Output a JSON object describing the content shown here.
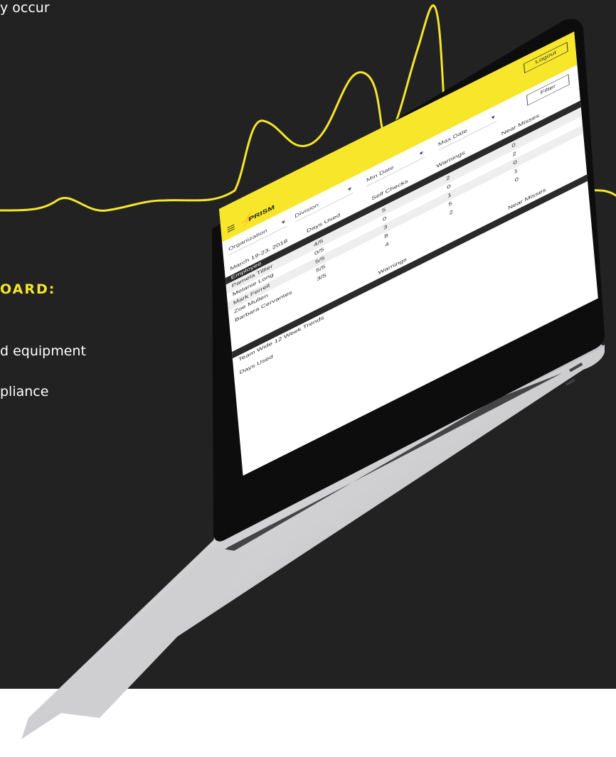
{
  "hero": {
    "top_text": "y occur",
    "heading": "OARD:",
    "bullet_1": "d equipment",
    "bullet_2": "pliance"
  },
  "app": {
    "logo": "PRISM",
    "logout_label": "Logout",
    "filters": {
      "organization": "Organization",
      "division": "Division",
      "min_date": "Min Date",
      "max_date": "Max Date",
      "filter_button": "Filter"
    },
    "date_range": "March 19-23, 2018",
    "table": {
      "headers": [
        "Employee",
        "Days Used",
        "Self Checks",
        "Warnings",
        "Near Misses"
      ],
      "rows": [
        {
          "name": "Pamela Tillier",
          "days": "4/5",
          "checks": "5",
          "warnings": "2",
          "misses": "0"
        },
        {
          "name": "Melanie Long",
          "days": "0/5",
          "checks": "0",
          "warnings": "0",
          "misses": "2"
        },
        {
          "name": "Mark Ferrell",
          "days": "5/5",
          "checks": "3",
          "warnings": "1",
          "misses": "0"
        },
        {
          "name": "Zoe Mullen",
          "days": "5/5",
          "checks": "8",
          "warnings": "5",
          "misses": "1"
        },
        {
          "name": "Barbara Cervantes",
          "days": "3/5",
          "checks": "4",
          "warnings": "2",
          "misses": "0"
        }
      ]
    },
    "trends": {
      "title": "Team Wide 12 Week Trends",
      "col_warnings": "Warnings",
      "col_near_misses": "Near Misses",
      "row_days_used": "Days Used"
    }
  },
  "colors": {
    "background": "#222222",
    "accent": "#f5e52c",
    "app_bar": "#f7e629"
  }
}
